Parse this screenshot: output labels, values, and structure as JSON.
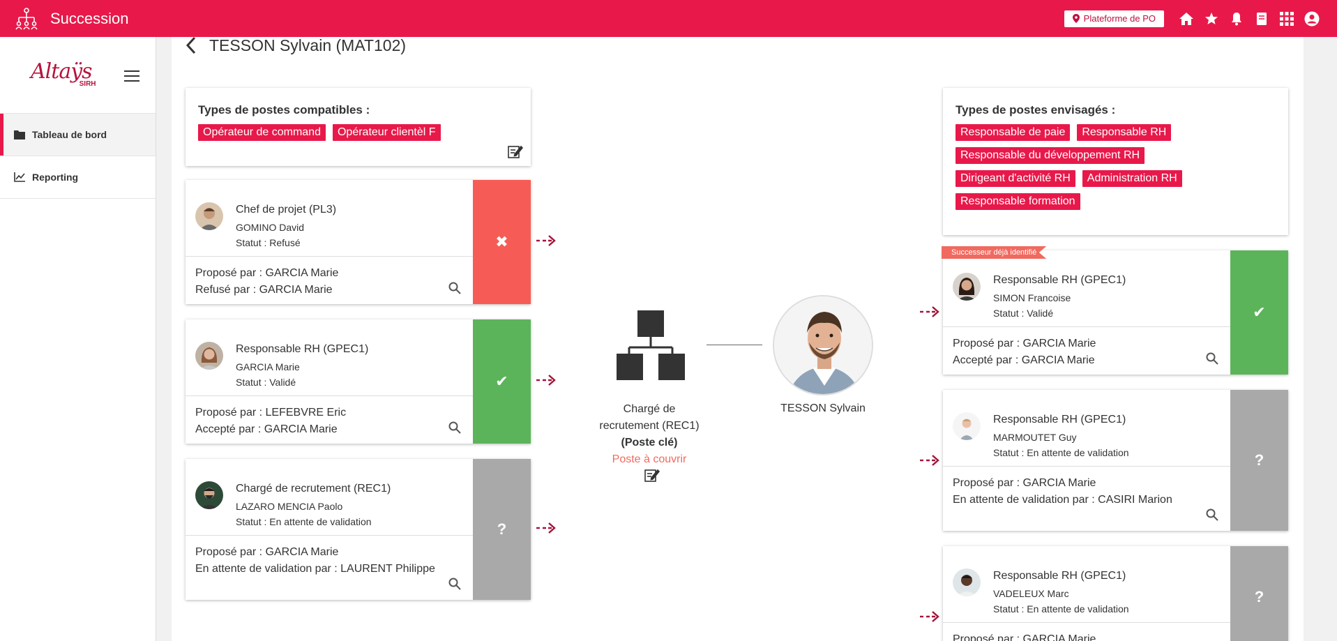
{
  "app": {
    "title": "Succession",
    "platform_label": "Plateforme de PO"
  },
  "sidebar": {
    "logo_brand": "Altaÿs",
    "logo_sub": "SIRH",
    "items": [
      {
        "label": "Tableau de bord",
        "icon": "folder-icon",
        "active": true
      },
      {
        "label": "Reporting",
        "icon": "line-chart-icon",
        "active": false
      }
    ]
  },
  "page": {
    "title": "TESSON Sylvain (MAT102)"
  },
  "compatible": {
    "heading": "Types de postes compatibles :",
    "tags": [
      "Opérateur de command",
      "Opérateur clientèl F"
    ]
  },
  "envisaged": {
    "heading": "Types de postes envisagés :",
    "tags": [
      "Responsable de paie",
      "Responsable RH",
      "Responsable du développement RH",
      "Dirigeant d'activité RH",
      "Administration RH",
      "Responsable formation"
    ]
  },
  "left_cards": [
    {
      "position": "Chef de projet (PL3)",
      "name": "GOMINO David",
      "status": "Statut :  Refusé",
      "line1": "Proposé par : GARCIA Marie",
      "line2": "Refusé par : GARCIA Marie",
      "state": "refused",
      "symbol": "✖"
    },
    {
      "position": "Responsable RH (GPEC1)",
      "name": "GARCIA Marie",
      "status": "Statut :  Validé",
      "line1": "Proposé par : LEFEBVRE Eric",
      "line2": "Accepté par : GARCIA Marie",
      "state": "validated",
      "symbol": "✔"
    },
    {
      "position": "Chargé de recrutement (REC1)",
      "name": "LAZARO MENCIA Paolo",
      "status": "Statut :  En attente de validation",
      "line1": "Proposé par : GARCIA Marie",
      "line2": "En attente de validation par : LAURENT Philippe",
      "state": "pending",
      "symbol": "?"
    }
  ],
  "center": {
    "position_line1": "Chargé de",
    "position_line2": "recrutement (REC1)",
    "key_label": "(Poste clé)",
    "cover_label": "Poste à couvrir",
    "person_name": "TESSON Sylvain"
  },
  "right_cards": [
    {
      "ribbon": "Successeur déjà identifié",
      "position": "Responsable RH (GPEC1)",
      "name": "SIMON Francoise",
      "status": "Statut :  Validé",
      "line1": "Proposé par : GARCIA Marie",
      "line2": "Accepté par : GARCIA Marie",
      "state": "validated",
      "symbol": "✔"
    },
    {
      "position": "Responsable RH (GPEC1)",
      "name": "MARMOUTET Guy",
      "status": "Statut :  En attente de validation",
      "line1": "Proposé par : GARCIA Marie",
      "line2": "En attente de validation par : CASIRI Marion",
      "state": "pending",
      "symbol": "?"
    },
    {
      "position": "Responsable RH (GPEC1)",
      "name": "VADELEUX Marc",
      "status": "Statut :  En attente de validation",
      "line1": "Proposé par : GARCIA Marie",
      "line2": "",
      "state": "pending",
      "symbol": "?"
    }
  ],
  "colors": {
    "accent": "#e8194a",
    "refused": "#f65c55",
    "validated": "#5cb45a",
    "pending": "#a9a9a9"
  }
}
